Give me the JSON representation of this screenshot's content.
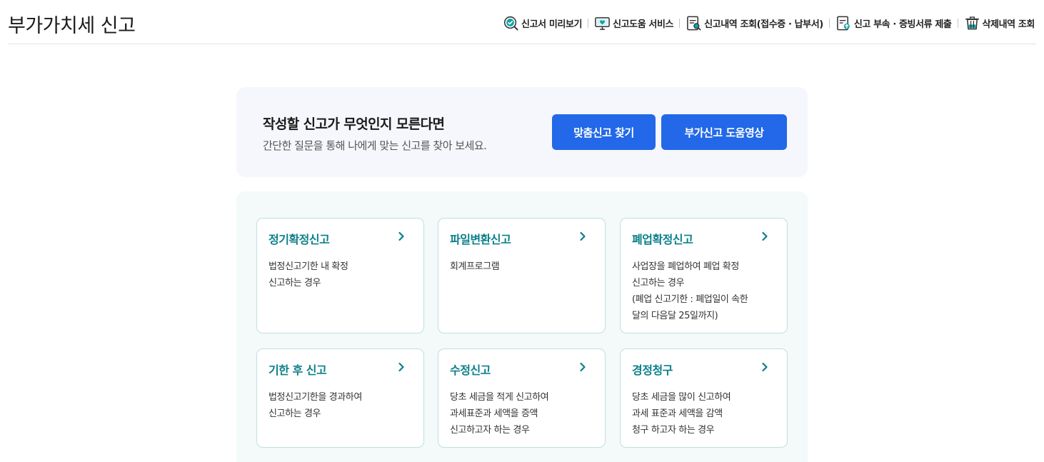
{
  "header": {
    "title": "부가가치세 신고",
    "tools": [
      {
        "label": "신고서 미리보기",
        "icon": "magnifier-check-icon"
      },
      {
        "label": "신고도움 서비스",
        "icon": "monitor-heart-icon"
      },
      {
        "label": "신고내역 조회(접수증 · 납부서)",
        "icon": "document-search-icon"
      },
      {
        "label": "신고 부속 · 증빙서류 제출",
        "icon": "document-upload-icon"
      },
      {
        "label": "삭제내역 조회",
        "icon": "trash-bin-icon"
      }
    ]
  },
  "guide": {
    "title": "작성할 신고가 무엇인지 모른다면",
    "description": "간단한 질문을 통해 나에게 맞는 신고를 찾아 보세요.",
    "find_button": "맞춤신고 찾기",
    "video_button": "부가신고 도움영상"
  },
  "cards": [
    {
      "title": "정기확정신고",
      "lines": [
        "법정신고기한 내 확정",
        "신고하는 경우"
      ]
    },
    {
      "title": "파일변환신고",
      "lines": [
        "회계프로그램"
      ]
    },
    {
      "title": "폐업확정신고",
      "lines": [
        "사업장을 폐업하여 폐업 확정",
        "신고하는 경우",
        "(폐업 신고기한 : 폐업일이 속한",
        "달의 다음달 25일까지)"
      ]
    },
    {
      "title": "기한 후 신고",
      "lines": [
        "법정신고기한을 경과하여",
        "신고하는 경우"
      ]
    },
    {
      "title": "수정신고",
      "lines": [
        "당초 세금을 적게 신고하여",
        "과세표준과 세액을 증액",
        "신고하고자 하는 경우"
      ]
    },
    {
      "title": "경정청구",
      "lines": [
        "당초 세금을 많이 신고하여",
        "과세 표준과 세액을 감액",
        "청구 하고자 하는 경우"
      ]
    }
  ],
  "colors": {
    "accent_blue": "#2268e8",
    "card_title_teal": "#0b7f8a",
    "panel_bg": "#f3faf9"
  }
}
